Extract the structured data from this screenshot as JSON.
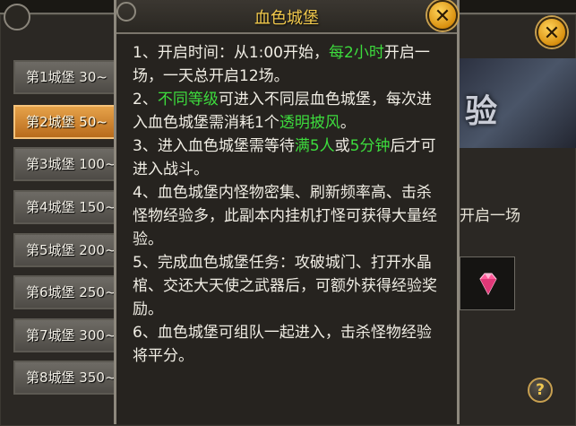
{
  "dialog": {
    "title": "血色城堡",
    "rules": [
      [
        "1、开启时间：从1:00开始，",
        {
          "hl": "每2小时"
        },
        "开启一场，一天总开启12场。"
      ],
      [
        "2、",
        {
          "hl": "不同等级"
        },
        "可进入不同层血色城堡，每次进入血色城堡需消耗1个",
        {
          "hl": "透明披风"
        },
        "。"
      ],
      [
        "3、进入血色城堡需等待",
        {
          "hl": "满5人"
        },
        "或",
        {
          "hl": "5分钟"
        },
        "后才可进入战斗。"
      ],
      [
        "4、血色城堡内怪物密集、刷新频率高、击杀怪物经验多，此副本内挂机打怪可获得大量经验。"
      ],
      [
        "5、完成血色城堡任务：攻破城门、打开水晶棺、交还大天使之武器后，可额外获得经验奖励。"
      ],
      [
        "6、血色城堡可组队一起进入，击杀怪物经验将平分。"
      ]
    ],
    "close_label": "✕"
  },
  "castle_list": {
    "selected_index": 1,
    "items": [
      "第1城堡 30~",
      "第2城堡 50~",
      "第3城堡 100~",
      "第4城堡 150~",
      "第5城堡 200~",
      "第6城堡 250~",
      "第7城堡 300~",
      "第8城堡 350~"
    ]
  },
  "side_panel": {
    "preview_text": "验",
    "info_text": "开启一场",
    "reward_icon": "pink-gem-icon",
    "help_label": "?",
    "close_label": "✕"
  },
  "colors": {
    "highlight": "#3ddc3d",
    "title": "#f2c94c",
    "selected_item": "#d88a2e"
  }
}
